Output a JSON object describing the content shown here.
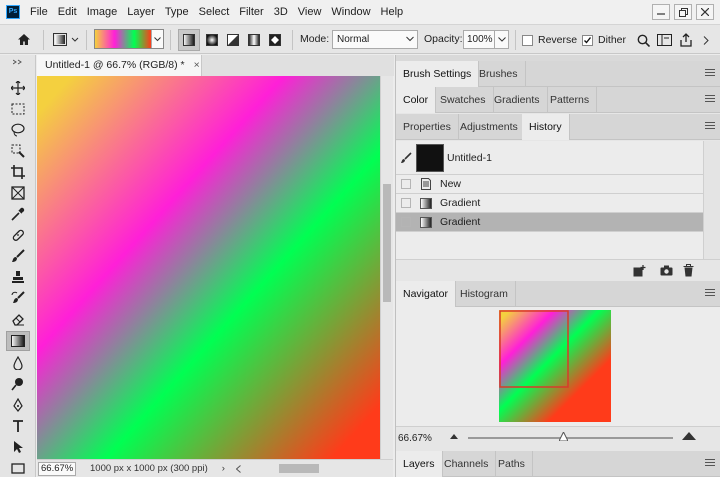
{
  "app": {
    "logo_text": "Ps"
  },
  "menu": [
    "File",
    "Edit",
    "Image",
    "Layer",
    "Type",
    "Select",
    "Filter",
    "3D",
    "View",
    "Window",
    "Help"
  ],
  "window_controls": [
    "minimize",
    "restore",
    "close"
  ],
  "options_bar": {
    "mode_label": "Mode:",
    "mode_value": "Normal",
    "opacity_label": "Opacity:",
    "opacity_value": "100%",
    "reverse_label": "Reverse",
    "reverse_checked": false,
    "dither_label": "Dither",
    "dither_checked": true,
    "gradient_types": [
      "linear",
      "radial",
      "angle",
      "reflected",
      "diamond"
    ],
    "active_gradient_type": "linear"
  },
  "document": {
    "tab_title": "Untitled-1 @ 66.7% (RGB/8) *",
    "close_glyph": "×",
    "zoom": "66.67%",
    "doc_info": "1000 px x 1000 px (300 ppi)",
    "nav_arrow": "›",
    "gradient_colors": [
      "#f4d03f",
      "#ff1fd8",
      "#00ff52",
      "#ff3b1a"
    ]
  },
  "tools": [
    "move",
    "marquee",
    "lasso",
    "quick-select",
    "crop",
    "frame",
    "eyedropper",
    "healing",
    "brush",
    "clone-stamp",
    "history-brush",
    "eraser",
    "gradient",
    "blur",
    "dodge",
    "pen",
    "type",
    "path-select",
    "rectangle"
  ],
  "active_tool": "gradient",
  "panels": {
    "group1_tabs": [
      "Brush Settings",
      "Brushes"
    ],
    "group2_tabs": [
      "Color",
      "Swatches",
      "Gradients",
      "Patterns"
    ],
    "group3_tabs": [
      "Properties",
      "Adjustments",
      "History"
    ],
    "group3_active": "History",
    "history": {
      "snapshot_label": "Untitled-1",
      "items": [
        "New",
        "Gradient",
        "Gradient"
      ],
      "selected_index": 2
    },
    "group4_tabs": [
      "Navigator",
      "Histogram"
    ],
    "navigator_zoom": "66.67%",
    "group5_tabs": [
      "Layers",
      "Channels",
      "Paths"
    ]
  }
}
